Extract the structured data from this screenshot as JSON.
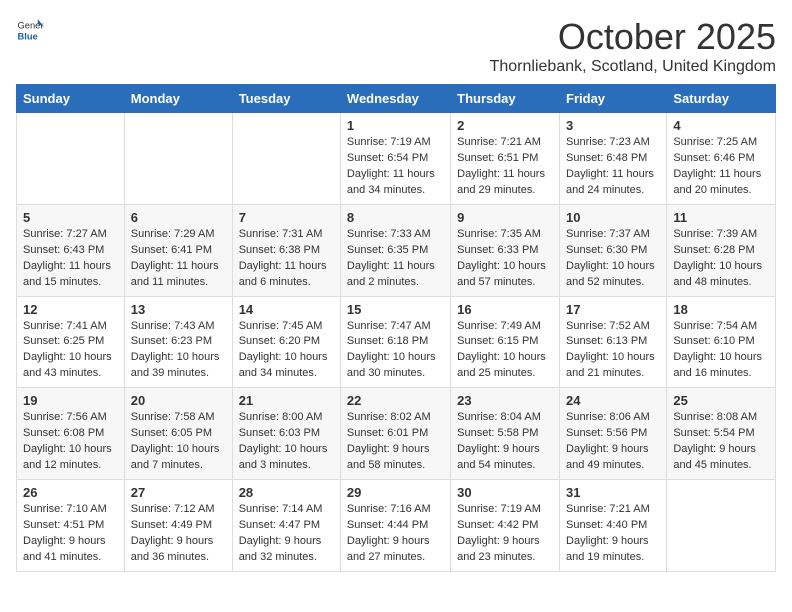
{
  "logo": {
    "general": "General",
    "blue": "Blue"
  },
  "title": "October 2025",
  "location": "Thornliebank, Scotland, United Kingdom",
  "headers": [
    "Sunday",
    "Monday",
    "Tuesday",
    "Wednesday",
    "Thursday",
    "Friday",
    "Saturday"
  ],
  "weeks": [
    [
      {
        "day": "",
        "info": ""
      },
      {
        "day": "",
        "info": ""
      },
      {
        "day": "",
        "info": ""
      },
      {
        "day": "1",
        "info": "Sunrise: 7:19 AM\nSunset: 6:54 PM\nDaylight: 11 hours\nand 34 minutes."
      },
      {
        "day": "2",
        "info": "Sunrise: 7:21 AM\nSunset: 6:51 PM\nDaylight: 11 hours\nand 29 minutes."
      },
      {
        "day": "3",
        "info": "Sunrise: 7:23 AM\nSunset: 6:48 PM\nDaylight: 11 hours\nand 24 minutes."
      },
      {
        "day": "4",
        "info": "Sunrise: 7:25 AM\nSunset: 6:46 PM\nDaylight: 11 hours\nand 20 minutes."
      }
    ],
    [
      {
        "day": "5",
        "info": "Sunrise: 7:27 AM\nSunset: 6:43 PM\nDaylight: 11 hours\nand 15 minutes."
      },
      {
        "day": "6",
        "info": "Sunrise: 7:29 AM\nSunset: 6:41 PM\nDaylight: 11 hours\nand 11 minutes."
      },
      {
        "day": "7",
        "info": "Sunrise: 7:31 AM\nSunset: 6:38 PM\nDaylight: 11 hours\nand 6 minutes."
      },
      {
        "day": "8",
        "info": "Sunrise: 7:33 AM\nSunset: 6:35 PM\nDaylight: 11 hours\nand 2 minutes."
      },
      {
        "day": "9",
        "info": "Sunrise: 7:35 AM\nSunset: 6:33 PM\nDaylight: 10 hours\nand 57 minutes."
      },
      {
        "day": "10",
        "info": "Sunrise: 7:37 AM\nSunset: 6:30 PM\nDaylight: 10 hours\nand 52 minutes."
      },
      {
        "day": "11",
        "info": "Sunrise: 7:39 AM\nSunset: 6:28 PM\nDaylight: 10 hours\nand 48 minutes."
      }
    ],
    [
      {
        "day": "12",
        "info": "Sunrise: 7:41 AM\nSunset: 6:25 PM\nDaylight: 10 hours\nand 43 minutes."
      },
      {
        "day": "13",
        "info": "Sunrise: 7:43 AM\nSunset: 6:23 PM\nDaylight: 10 hours\nand 39 minutes."
      },
      {
        "day": "14",
        "info": "Sunrise: 7:45 AM\nSunset: 6:20 PM\nDaylight: 10 hours\nand 34 minutes."
      },
      {
        "day": "15",
        "info": "Sunrise: 7:47 AM\nSunset: 6:18 PM\nDaylight: 10 hours\nand 30 minutes."
      },
      {
        "day": "16",
        "info": "Sunrise: 7:49 AM\nSunset: 6:15 PM\nDaylight: 10 hours\nand 25 minutes."
      },
      {
        "day": "17",
        "info": "Sunrise: 7:52 AM\nSunset: 6:13 PM\nDaylight: 10 hours\nand 21 minutes."
      },
      {
        "day": "18",
        "info": "Sunrise: 7:54 AM\nSunset: 6:10 PM\nDaylight: 10 hours\nand 16 minutes."
      }
    ],
    [
      {
        "day": "19",
        "info": "Sunrise: 7:56 AM\nSunset: 6:08 PM\nDaylight: 10 hours\nand 12 minutes."
      },
      {
        "day": "20",
        "info": "Sunrise: 7:58 AM\nSunset: 6:05 PM\nDaylight: 10 hours\nand 7 minutes."
      },
      {
        "day": "21",
        "info": "Sunrise: 8:00 AM\nSunset: 6:03 PM\nDaylight: 10 hours\nand 3 minutes."
      },
      {
        "day": "22",
        "info": "Sunrise: 8:02 AM\nSunset: 6:01 PM\nDaylight: 9 hours\nand 58 minutes."
      },
      {
        "day": "23",
        "info": "Sunrise: 8:04 AM\nSunset: 5:58 PM\nDaylight: 9 hours\nand 54 minutes."
      },
      {
        "day": "24",
        "info": "Sunrise: 8:06 AM\nSunset: 5:56 PM\nDaylight: 9 hours\nand 49 minutes."
      },
      {
        "day": "25",
        "info": "Sunrise: 8:08 AM\nSunset: 5:54 PM\nDaylight: 9 hours\nand 45 minutes."
      }
    ],
    [
      {
        "day": "26",
        "info": "Sunrise: 7:10 AM\nSunset: 4:51 PM\nDaylight: 9 hours\nand 41 minutes."
      },
      {
        "day": "27",
        "info": "Sunrise: 7:12 AM\nSunset: 4:49 PM\nDaylight: 9 hours\nand 36 minutes."
      },
      {
        "day": "28",
        "info": "Sunrise: 7:14 AM\nSunset: 4:47 PM\nDaylight: 9 hours\nand 32 minutes."
      },
      {
        "day": "29",
        "info": "Sunrise: 7:16 AM\nSunset: 4:44 PM\nDaylight: 9 hours\nand 27 minutes."
      },
      {
        "day": "30",
        "info": "Sunrise: 7:19 AM\nSunset: 4:42 PM\nDaylight: 9 hours\nand 23 minutes."
      },
      {
        "day": "31",
        "info": "Sunrise: 7:21 AM\nSunset: 4:40 PM\nDaylight: 9 hours\nand 19 minutes."
      },
      {
        "day": "",
        "info": ""
      }
    ]
  ]
}
